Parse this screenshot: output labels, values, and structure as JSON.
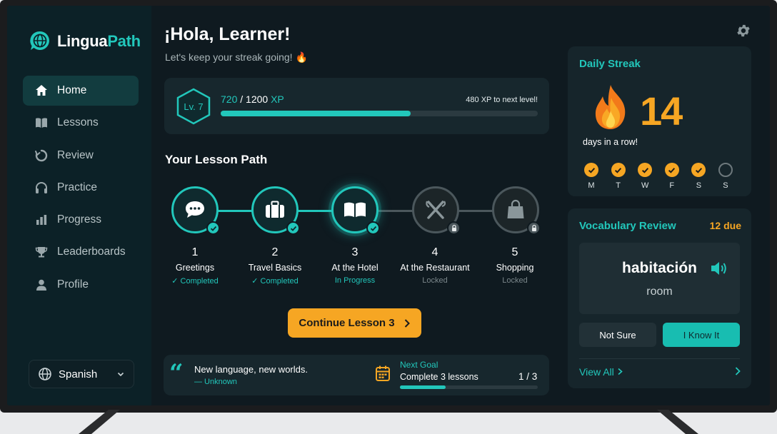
{
  "app": {
    "name_part1": "Lingua",
    "name_part2": "Path",
    "brand_color": "#22c7bb",
    "accent_color": "#f6a623"
  },
  "sidebar": {
    "items": [
      {
        "label": "Home",
        "icon": "home-icon",
        "active": true
      },
      {
        "label": "Lessons",
        "icon": "book-icon",
        "active": false
      },
      {
        "label": "Review",
        "icon": "refresh-icon",
        "active": false
      },
      {
        "label": "Practice",
        "icon": "headphones-icon",
        "active": false
      },
      {
        "label": "Progress",
        "icon": "bar-chart-icon",
        "active": false
      },
      {
        "label": "Leaderboards",
        "icon": "trophy-icon",
        "active": false
      },
      {
        "label": "Profile",
        "icon": "user-icon",
        "active": false
      }
    ],
    "language": "Spanish"
  },
  "header": {
    "greeting": "¡Hola, Learner!",
    "subtitle": "Let's keep your streak going! 🔥"
  },
  "xp": {
    "level": "Lv. 7",
    "current": "720",
    "separator": " / ",
    "total": "1200",
    "unit": " XP",
    "next_level": "480 XP to next level!",
    "progress": 0.6
  },
  "lesson_path": {
    "title": "Your Lesson Path",
    "lessons": [
      {
        "number": "1",
        "name": "Greetings",
        "status": "✓ Completed",
        "state": "done",
        "icon": "speech-bubble-icon"
      },
      {
        "number": "2",
        "name": "Travel Basics",
        "status": "✓ Completed",
        "state": "done",
        "icon": "suitcase-icon"
      },
      {
        "number": "3",
        "name": "At the Hotel",
        "status": "In Progress",
        "state": "current",
        "icon": "open-book-icon"
      },
      {
        "number": "4",
        "name": "At the Restaurant",
        "status": "Locked",
        "state": "locked",
        "icon": "utensils-icon"
      },
      {
        "number": "5",
        "name": "Shopping",
        "status": "Locked",
        "state": "locked",
        "icon": "shopping-bag-icon"
      }
    ],
    "continue_label": "Continue Lesson 3"
  },
  "quote": {
    "mark": "“",
    "text": "New language, new worlds.",
    "author": "— Unknown"
  },
  "goal": {
    "label": "Next Goal",
    "text": "Complete 3 lessons",
    "count": "1 / 3",
    "progress": 0.33
  },
  "streak": {
    "title": "Daily Streak",
    "count": "14",
    "subtitle": "days in a row!",
    "days": [
      {
        "label": "M",
        "done": true
      },
      {
        "label": "T",
        "done": true
      },
      {
        "label": "W",
        "done": true
      },
      {
        "label": "F",
        "done": true
      },
      {
        "label": "S",
        "done": true
      },
      {
        "label": "S",
        "done": false
      }
    ]
  },
  "vocab": {
    "title": "Vocabulary Review",
    "due": "12 due",
    "word": "habitación",
    "translation": "room",
    "not_sure_label": "Not Sure",
    "know_label": "I Know It",
    "view_all_label": "View All"
  }
}
